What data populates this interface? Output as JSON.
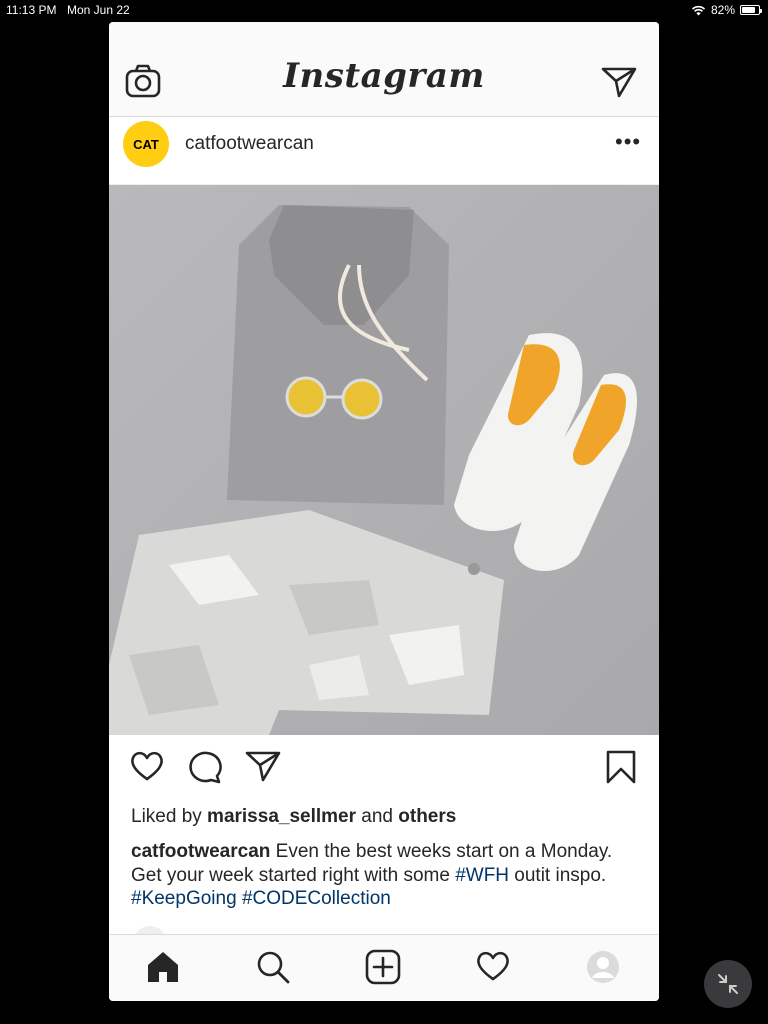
{
  "status_bar": {
    "time": "11:13 PM",
    "date": "Mon Jun 22",
    "battery": "82%",
    "battery_level": 0.82,
    "wifi_icon": "wifi-icon"
  },
  "header": {
    "logo": "Instagram",
    "left_icon": "camera-icon",
    "right_icon": "direct-send-icon"
  },
  "post": {
    "avatar_text": "CAT",
    "username": "catfootwearcan",
    "more_label": "•••",
    "image_icon": "post-photo",
    "liked_by_prefix": "Liked by ",
    "liked_by_user": "marissa_sellmer",
    "liked_by_mid": " and ",
    "liked_by_others": "others",
    "caption_user": "catfootwearcan",
    "caption_text_1": " Even the best weeks start on a Monday. Get your week started right with some ",
    "hashtag_1": "#WFH",
    "caption_text_2": " outit inspo. ",
    "hashtag_2": "#KeepGoing",
    "caption_space": " ",
    "hashtag_3": "#CODECollection"
  },
  "actions": {
    "like": "heart-icon",
    "comment": "comment-icon",
    "share": "share-icon",
    "save": "bookmark-icon"
  },
  "tabbar": {
    "items": [
      "home-icon",
      "search-icon",
      "add-post-icon",
      "activity-heart-icon",
      "profile-icon"
    ]
  },
  "colors": {
    "hashtag": "#003569",
    "cat_yellow": "#ffcd11",
    "photo_bg": "#b4b4b6"
  }
}
